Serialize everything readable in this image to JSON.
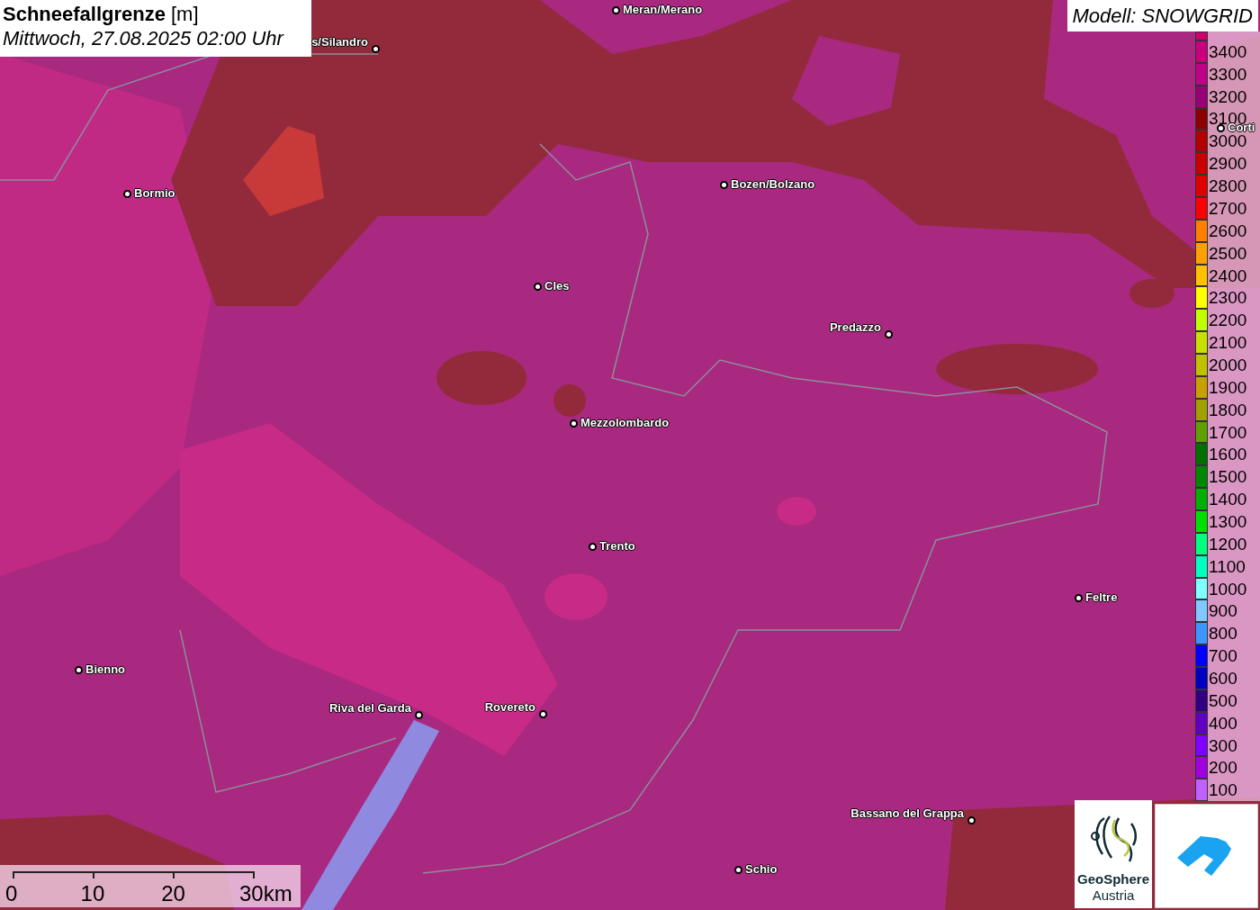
{
  "title": {
    "parameter": "Schneefallgrenze",
    "unit": "[m]",
    "datetime": "Mittwoch, 27.08.2025 02:00 Uhr"
  },
  "model": "Modell: SNOWGRID",
  "places": [
    {
      "name": "Meran/Merano"
    },
    {
      "name": "s/Silandro"
    },
    {
      "name": "Bormio"
    },
    {
      "name": "Bozen/Bolzano"
    },
    {
      "name": "Cles"
    },
    {
      "name": "Predazzo"
    },
    {
      "name": "Mezzolombardo"
    },
    {
      "name": "Trento"
    },
    {
      "name": "Feltre"
    },
    {
      "name": "Bienno"
    },
    {
      "name": "Riva del Garda"
    },
    {
      "name": "Rovereto"
    },
    {
      "name": "Bassano del Grappa"
    },
    {
      "name": "Schio"
    },
    {
      "name": "Corti"
    }
  ],
  "legend": [
    {
      "color": "#d0006e"
    },
    {
      "label": "3400",
      "color": "#c8007e"
    },
    {
      "label": "3300",
      "color": "#c00088"
    },
    {
      "label": "3200",
      "color": "#980078"
    },
    {
      "label": "3100",
      "color": "#8b0000"
    },
    {
      "label": "3000",
      "color": "#b00000"
    },
    {
      "label": "2900",
      "color": "#c80000"
    },
    {
      "label": "2800",
      "color": "#e00000"
    },
    {
      "label": "2700",
      "color": "#ff0000"
    },
    {
      "label": "2600",
      "color": "#ff8000"
    },
    {
      "label": "2500",
      "color": "#ffa000"
    },
    {
      "label": "2400",
      "color": "#ffc000"
    },
    {
      "label": "2300",
      "color": "#ffff00"
    },
    {
      "label": "2200",
      "color": "#c0ff00"
    },
    {
      "label": "2100",
      "color": "#c8e000"
    },
    {
      "label": "2000",
      "color": "#c0c000"
    },
    {
      "label": "1900",
      "color": "#c8a000"
    },
    {
      "label": "1800",
      "color": "#a0a000"
    },
    {
      "label": "1700",
      "color": "#60a000"
    },
    {
      "label": "1600",
      "color": "#007000"
    },
    {
      "label": "1500",
      "color": "#008800"
    },
    {
      "label": "1400",
      "color": "#00b000"
    },
    {
      "label": "1300",
      "color": "#00e000"
    },
    {
      "label": "1200",
      "color": "#00ff80"
    },
    {
      "label": "1100",
      "color": "#00ffc0"
    },
    {
      "label": "1000",
      "color": "#80ffff"
    },
    {
      "label": "900",
      "color": "#80c8ff"
    },
    {
      "label": "800",
      "color": "#3c96ff"
    },
    {
      "label": "700",
      "color": "#0000ff"
    },
    {
      "label": "600",
      "color": "#0000c0"
    },
    {
      "label": "500",
      "color": "#300080"
    },
    {
      "label": "400",
      "color": "#6000c0"
    },
    {
      "label": "300",
      "color": "#8000ff"
    },
    {
      "label": "200",
      "color": "#a000e0"
    },
    {
      "label": "100",
      "color": "#c060ff"
    }
  ],
  "scale": {
    "ticks": [
      "0",
      "10",
      "20",
      "30km"
    ]
  },
  "logos": {
    "geosphere_line1": "GeoSphere",
    "geosphere_line2": "Austria"
  }
}
